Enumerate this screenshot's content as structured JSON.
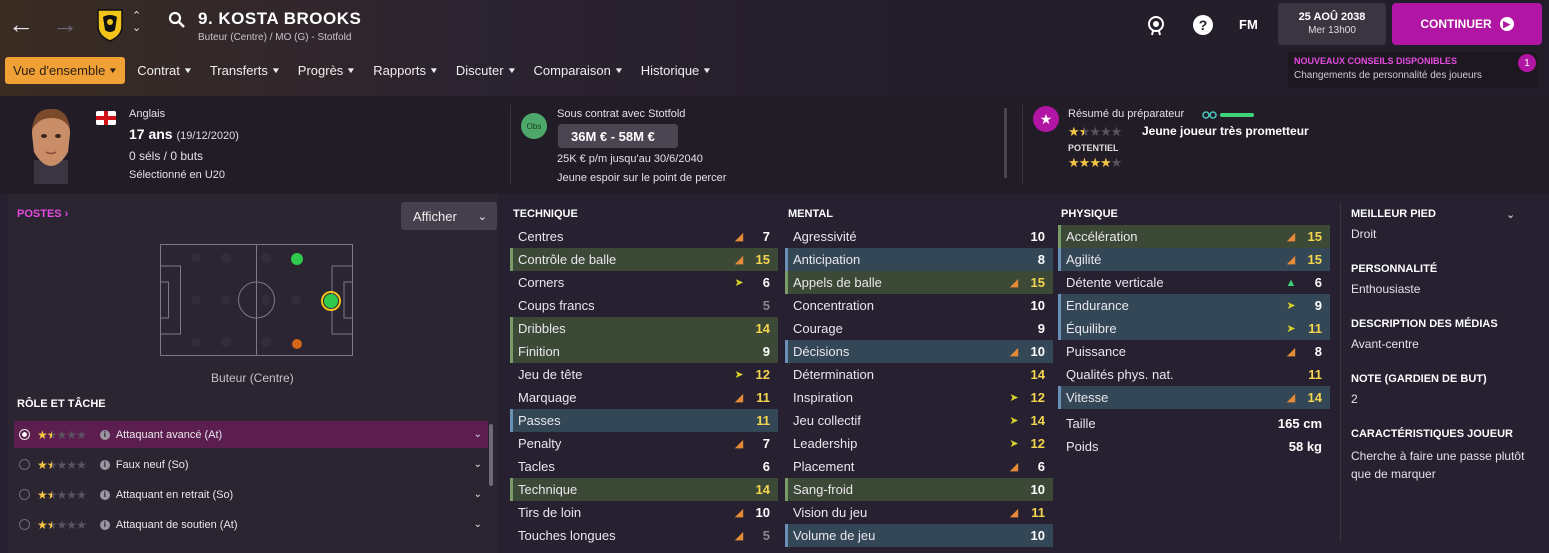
{
  "header": {
    "player_name": "9. KOSTA BROOKS",
    "player_subtitle": "Buteur (Centre) / MO (G) - Stotfold",
    "fm_label": "FM",
    "date": "25 AOÛ 2038",
    "day_time": "Mer 13h00",
    "continue_label": "CONTINUER"
  },
  "menu": {
    "items": [
      "Vue d'ensemble",
      "Contrat",
      "Transferts",
      "Progrès",
      "Rapports",
      "Discuter",
      "Comparaison",
      "Historique"
    ]
  },
  "notification": {
    "title": "NOUVEAUX CONSEILS DISPONIBLES",
    "text": "Changements de personnalité des joueurs",
    "count": "1"
  },
  "info": {
    "nationality": "Anglais",
    "age": "17 ans",
    "dob": "(19/12/2020)",
    "apps_goals": "0 séls / 0 buts",
    "selected": "Sélectionné en U20",
    "obs_label": "Obs",
    "contract_with": "Sous contrat avec Stotfold",
    "value_range": "36M € - 58M €",
    "wage": "25K € p/m jusqu'au 30/6/2040",
    "prospect": "Jeune espoir sur le point de percer",
    "coach_summary_label": "Résumé du préparateur",
    "coach_summary": "Jeune joueur très prometteur",
    "potential_label": "POTENTIEL",
    "ability_stars": 1.5,
    "potential_stars": 4
  },
  "positions": {
    "link_label": "POSTES",
    "show_button": "Afficher",
    "caption": "Buteur (Centre)"
  },
  "roles": {
    "heading": "RÔLE ET TÂCHE",
    "items": [
      {
        "label": "Attaquant avancé (At)",
        "stars": 1.5,
        "selected": true
      },
      {
        "label": "Faux neuf (So)",
        "stars": 1.5,
        "selected": false
      },
      {
        "label": "Attaquant en retrait (So)",
        "stars": 1.5,
        "selected": false
      },
      {
        "label": "Attaquant de soutien (At)",
        "stars": 1.5,
        "selected": false
      }
    ]
  },
  "attributes": {
    "technical": {
      "title": "TECHNIQUE",
      "rows": [
        {
          "name": "Centres",
          "value": "7",
          "arrow": "orange",
          "hl": ""
        },
        {
          "name": "Contrôle de balle",
          "value": "15",
          "arrow": "orange",
          "hl": "green"
        },
        {
          "name": "Corners",
          "value": "6",
          "arrow": "yellow",
          "hl": ""
        },
        {
          "name": "Coups francs",
          "value": "5",
          "arrow": "",
          "hl": ""
        },
        {
          "name": "Dribbles",
          "value": "14",
          "arrow": "",
          "hl": "green"
        },
        {
          "name": "Finition",
          "value": "9",
          "arrow": "",
          "hl": "green"
        },
        {
          "name": "Jeu de tête",
          "value": "12",
          "arrow": "yellow",
          "hl": ""
        },
        {
          "name": "Marquage",
          "value": "11",
          "arrow": "orange",
          "hl": ""
        },
        {
          "name": "Passes",
          "value": "11",
          "arrow": "",
          "hl": "blue"
        },
        {
          "name": "Penalty",
          "value": "7",
          "arrow": "orange",
          "hl": ""
        },
        {
          "name": "Tacles",
          "value": "6",
          "arrow": "",
          "hl": ""
        },
        {
          "name": "Technique",
          "value": "14",
          "arrow": "",
          "hl": "green"
        },
        {
          "name": "Tirs de loin",
          "value": "10",
          "arrow": "orange",
          "hl": ""
        },
        {
          "name": "Touches longues",
          "value": "5",
          "arrow": "orange",
          "hl": ""
        }
      ]
    },
    "mental": {
      "title": "MENTAL",
      "rows": [
        {
          "name": "Agressivité",
          "value": "10",
          "arrow": "",
          "hl": ""
        },
        {
          "name": "Anticipation",
          "value": "8",
          "arrow": "",
          "hl": "blue"
        },
        {
          "name": "Appels de balle",
          "value": "15",
          "arrow": "orange",
          "hl": "green"
        },
        {
          "name": "Concentration",
          "value": "10",
          "arrow": "",
          "hl": ""
        },
        {
          "name": "Courage",
          "value": "9",
          "arrow": "",
          "hl": ""
        },
        {
          "name": "Décisions",
          "value": "10",
          "arrow": "orange",
          "hl": "blue"
        },
        {
          "name": "Détermination",
          "value": "14",
          "arrow": "",
          "hl": ""
        },
        {
          "name": "Inspiration",
          "value": "12",
          "arrow": "yellow",
          "hl": ""
        },
        {
          "name": "Jeu collectif",
          "value": "14",
          "arrow": "yellow",
          "hl": ""
        },
        {
          "name": "Leadership",
          "value": "12",
          "arrow": "yellow",
          "hl": ""
        },
        {
          "name": "Placement",
          "value": "6",
          "arrow": "orange",
          "hl": ""
        },
        {
          "name": "Sang-froid",
          "value": "10",
          "arrow": "",
          "hl": "green"
        },
        {
          "name": "Vision du jeu",
          "value": "11",
          "arrow": "orange",
          "hl": ""
        },
        {
          "name": "Volume de jeu",
          "value": "10",
          "arrow": "",
          "hl": "blue"
        }
      ]
    },
    "physical": {
      "title": "PHYSIQUE",
      "rows": [
        {
          "name": "Accélération",
          "value": "15",
          "arrow": "orange",
          "hl": "green"
        },
        {
          "name": "Agilité",
          "value": "15",
          "arrow": "orange",
          "hl": "blue"
        },
        {
          "name": "Détente verticale",
          "value": "6",
          "arrow": "green",
          "hl": ""
        },
        {
          "name": "Endurance",
          "value": "9",
          "arrow": "yellow",
          "hl": "blue"
        },
        {
          "name": "Équilibre",
          "value": "11",
          "arrow": "yellow",
          "hl": "blue"
        },
        {
          "name": "Puissance",
          "value": "8",
          "arrow": "orange",
          "hl": ""
        },
        {
          "name": "Qualités phys. nat.",
          "value": "11",
          "arrow": "",
          "hl": ""
        },
        {
          "name": "Vitesse",
          "value": "14",
          "arrow": "orange",
          "hl": "blue"
        }
      ],
      "height_label": "Taille",
      "height": "165 cm",
      "weight_label": "Poids",
      "weight": "58 kg"
    }
  },
  "side": {
    "best_foot_title": "MEILLEUR PIED",
    "best_foot": "Droit",
    "personality_title": "PERSONNALITÉ",
    "personality": "Enthousiaste",
    "media_title": "DESCRIPTION DES MÉDIAS",
    "media": "Avant-centre",
    "gk_title": "NOTE (GARDIEN DE BUT)",
    "gk": "2",
    "traits_title": "CARACTÉRISTIQUES JOUEUR",
    "traits": "Cherche à faire une passe plutôt que de marquer"
  }
}
